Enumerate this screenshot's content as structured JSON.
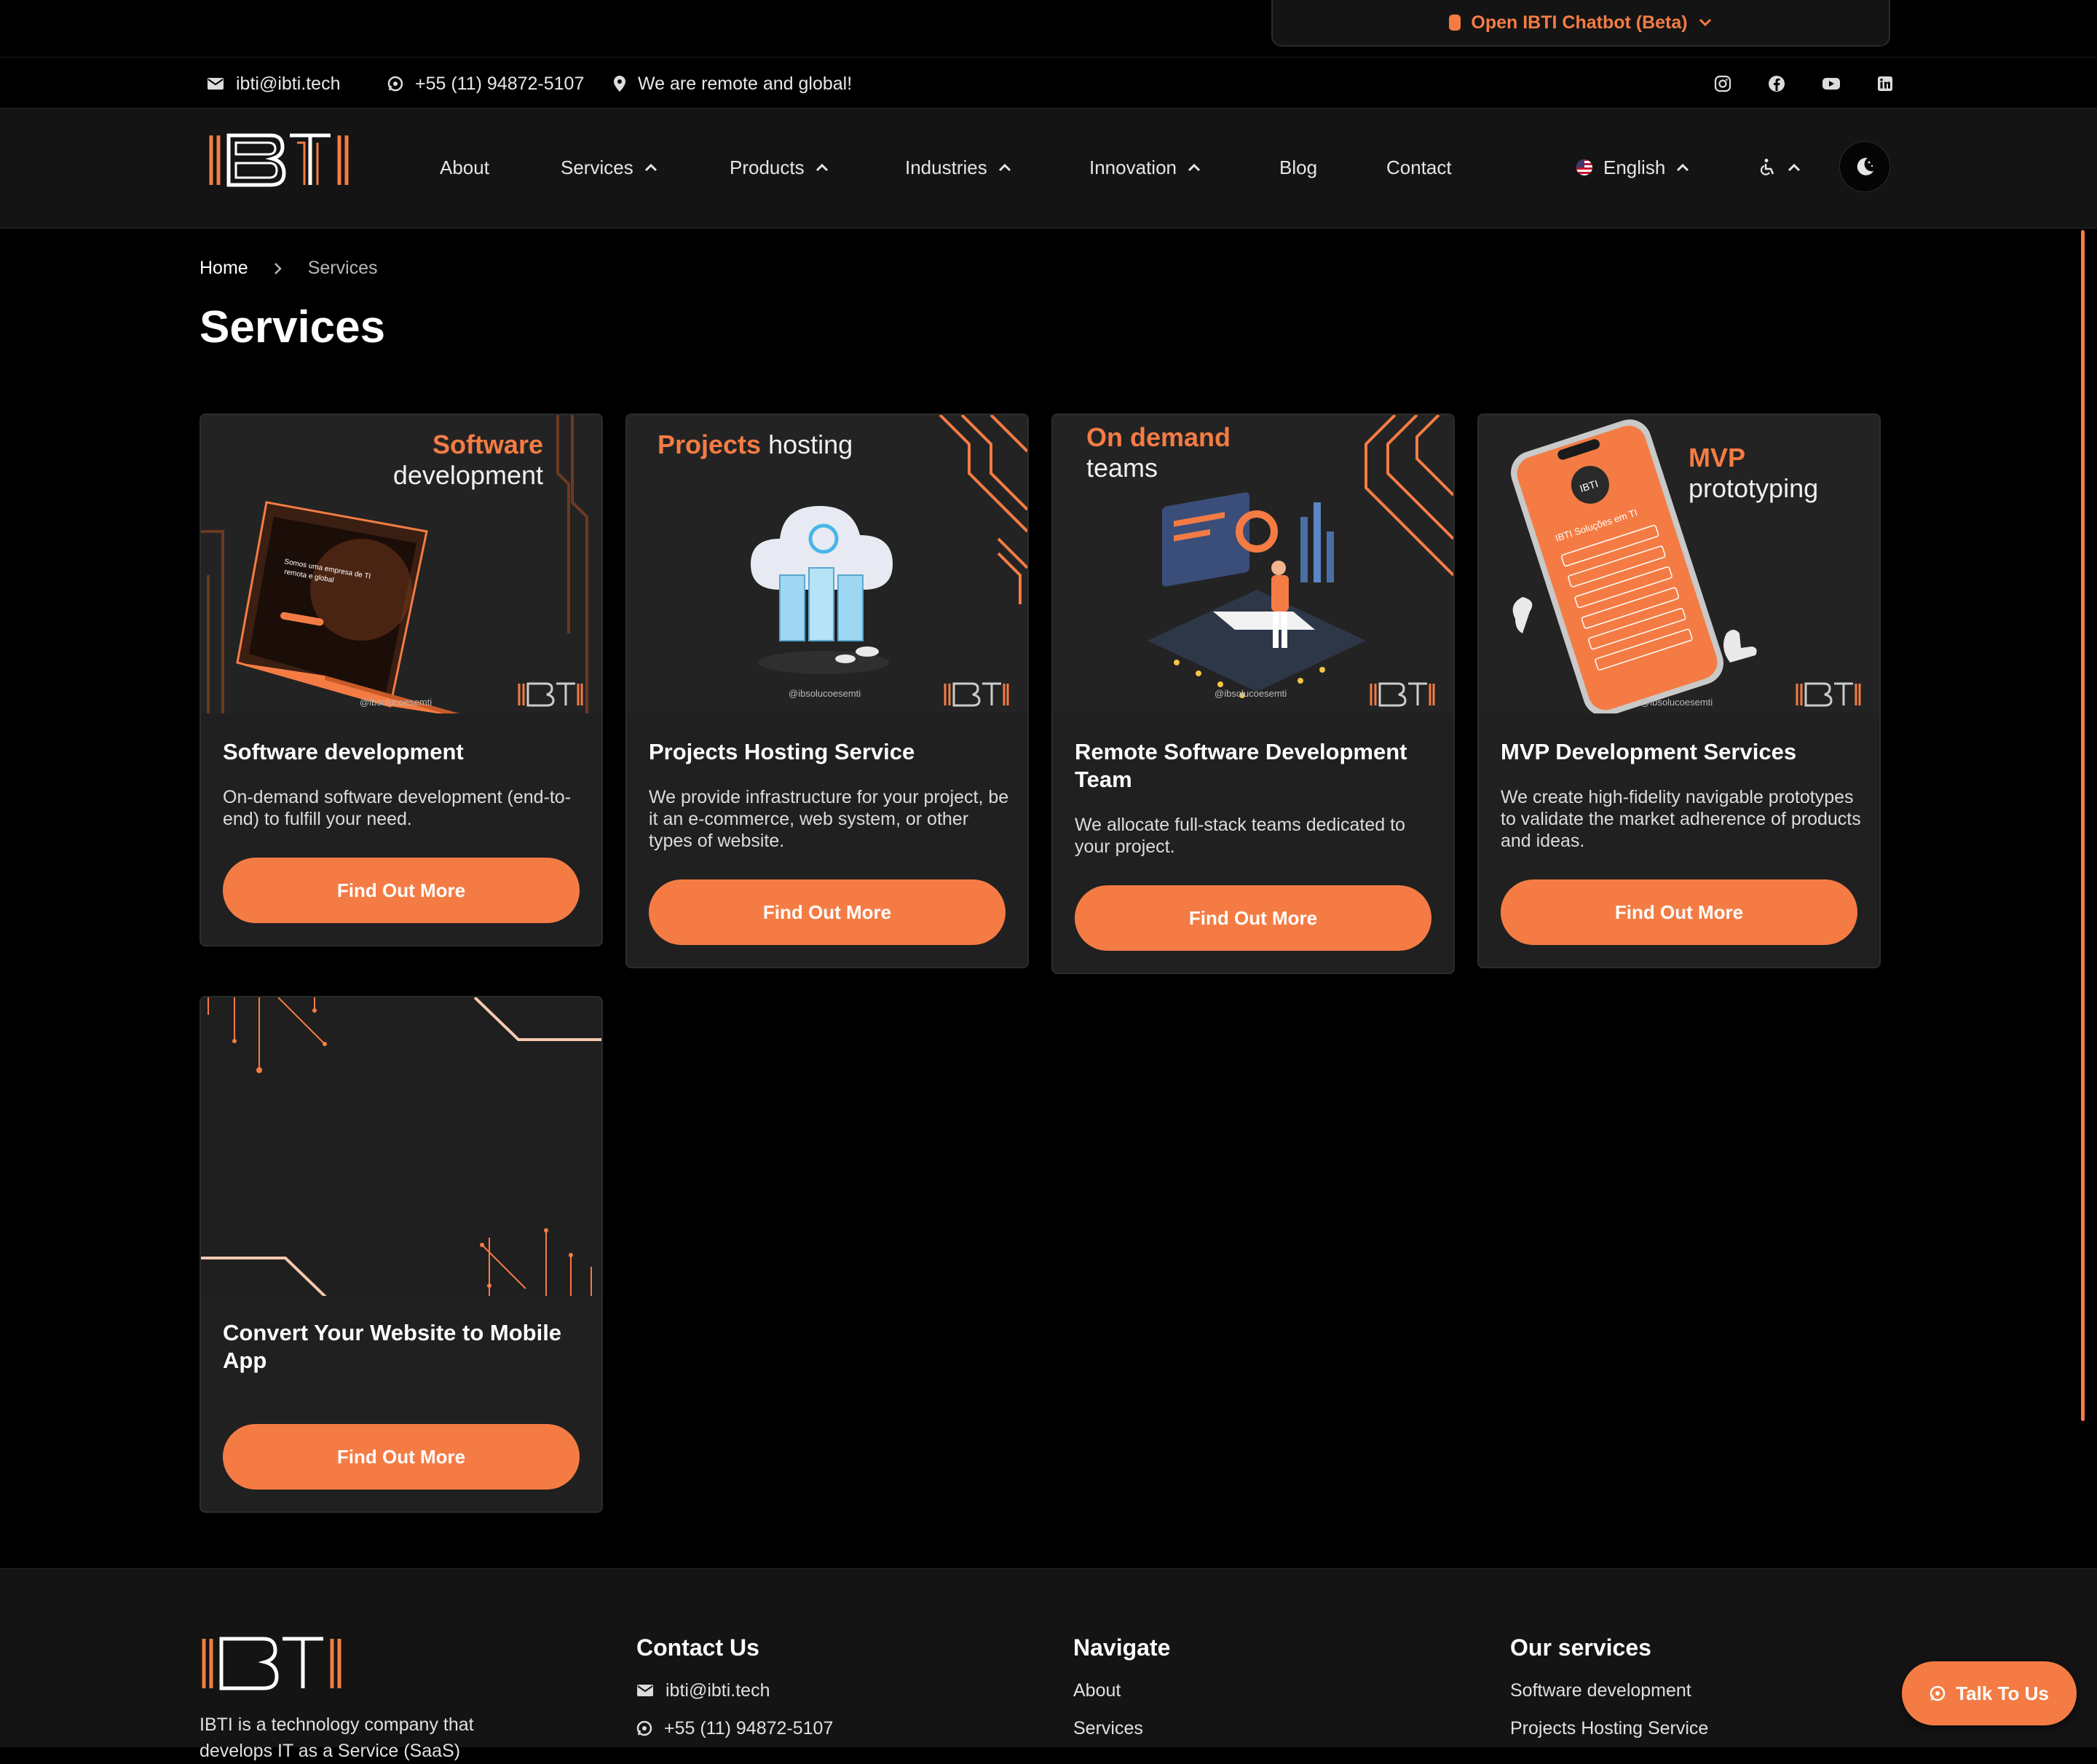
{
  "chatbot": {
    "label": "Open IBTI Chatbot (Beta)"
  },
  "contact_bar": {
    "email": "ibti@ibti.tech",
    "phone": "+55 (11) 94872-5107",
    "location": "We are remote and global!",
    "socials": [
      "instagram-icon",
      "facebook-icon",
      "youtube-icon",
      "linkedin-icon"
    ]
  },
  "nav": {
    "logo_text": "IBTI",
    "items": [
      {
        "label": "About"
      },
      {
        "label": "Services"
      },
      {
        "label": "Products"
      },
      {
        "label": "Industries"
      },
      {
        "label": "Innovation"
      },
      {
        "label": "Blog"
      },
      {
        "label": "Contact"
      }
    ],
    "language": "English"
  },
  "breadcrumb": {
    "home": "Home",
    "current": "Services"
  },
  "page": {
    "title": "Services"
  },
  "cards": [
    {
      "image": {
        "highlight": "Software",
        "rest": "development",
        "handle": "@ibsolucoesemti"
      },
      "title": "Software development",
      "description": "On-demand software development (end-to-end) to fulfill your need.",
      "button": "Find Out More"
    },
    {
      "image": {
        "highlight": "Projects",
        "rest": "hosting",
        "handle": "@ibsolucoesemti"
      },
      "title": "Projects Hosting Service",
      "description": "We provide infrastructure for your project, be it an e-commerce, web system, or other types of website.",
      "button": "Find Out More"
    },
    {
      "image": {
        "highlight": "On demand",
        "rest": "teams",
        "handle": "@ibsolucoesemti"
      },
      "title": "Remote Software Development Team",
      "description": "We allocate full-stack teams dedicated to your project.",
      "button": "Find Out More"
    },
    {
      "image": {
        "highlight": "MVP",
        "rest": "prototyping",
        "handle": "@ibsolucoesemti"
      },
      "title": "MVP Development Services",
      "description": "We create high-fidelity navigable prototypes to validate the market adherence of products and ideas.",
      "button": "Find Out More"
    },
    {
      "title": "Convert Your Website to Mobile App",
      "description": "",
      "button": "Find Out More"
    }
  ],
  "footer": {
    "about": "IBTI is a technology company that develops IT as a Service (SaaS)",
    "contact_title": "Contact Us",
    "contact_email": "ibti@ibti.tech",
    "contact_phone": "+55 (11) 94872-5107",
    "navigate_title": "Navigate",
    "navigate_links": [
      "About",
      "Services"
    ],
    "services_title": "Our services",
    "services_links": [
      "Software development",
      "Projects Hosting Service"
    ]
  },
  "talk_button": {
    "label": "Talk To Us"
  },
  "colors": {
    "accent": "#f47c44",
    "background": "#000000",
    "surface": "#202020"
  }
}
